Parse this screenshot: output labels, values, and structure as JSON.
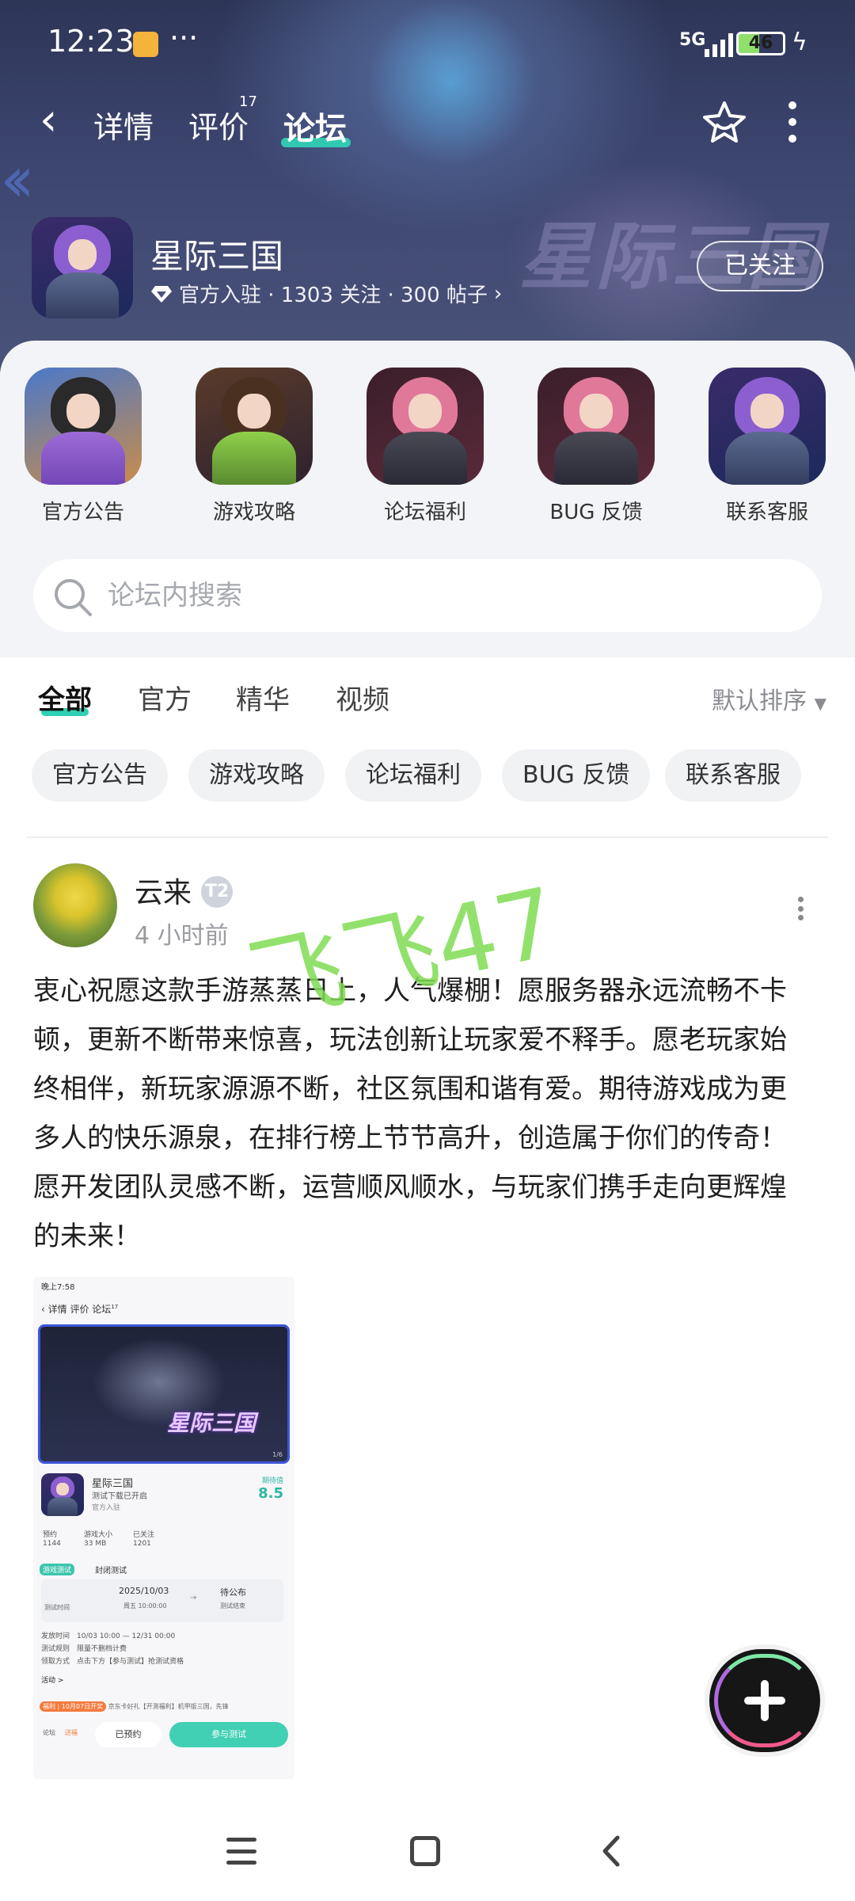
{
  "status_bar": {
    "time": "12:23",
    "dots": "···",
    "network": "5G",
    "battery": "46"
  },
  "nav": {
    "tabs": [
      {
        "label": "详情"
      },
      {
        "label": "评价",
        "badge": "17"
      },
      {
        "label": "论坛"
      }
    ],
    "active_tab": "论坛"
  },
  "game": {
    "name": "星际三国",
    "meta": "官方入驻 · 1303 关注 · 300 帖子",
    "follow_label": "已关注",
    "hero_logo": "星际三国"
  },
  "categories": [
    {
      "label": "官方公告"
    },
    {
      "label": "游戏攻略"
    },
    {
      "label": "论坛福利"
    },
    {
      "label": "BUG 反馈"
    },
    {
      "label": "联系客服"
    }
  ],
  "search": {
    "placeholder": "论坛内搜索"
  },
  "feed_tabs": [
    {
      "label": "全部"
    },
    {
      "label": "官方"
    },
    {
      "label": "精华"
    },
    {
      "label": "视频"
    }
  ],
  "sort_label": "默认排序",
  "chips": [
    "官方公告",
    "游戏攻略",
    "论坛福利",
    "BUG 反馈",
    "联系客服"
  ],
  "post": {
    "author": "云来",
    "author_badge": "T2",
    "time": "4 小时前",
    "content": "衷心祝愿这款手游蒸蒸日上，人气爆棚！愿服务器永远流畅不卡顿，更新不断带来惊喜，玩法创新让玩家爱不释手。愿老玩家始终相伴，新玩家源源不断，社区氛围和谐有爱。期待游戏成为更多人的快乐源泉，在排行榜上节节高升，创造属于你们的传奇！愿开发团队灵感不断，运营顺风顺水，与玩家们携手走向更辉煌的未来！",
    "watermark": "飞飞47"
  },
  "embedded_shot": {
    "status_time": "晚上7:58",
    "nav_tabs": "详情  评价  论坛",
    "nav_badge": "17",
    "banner_logo": "星际三国",
    "banner_page": "1/6",
    "name": "星际三国",
    "subtitle": "测试下载已开启",
    "official": "官方入驻",
    "score_label": "期待值",
    "score": "8.5",
    "stats": [
      {
        "label": "预约",
        "value": "1144"
      },
      {
        "label": "游戏大小",
        "value": "33 MB"
      },
      {
        "label": "已关注",
        "value": "1201"
      }
    ],
    "test_tag": "游戏测试",
    "test_type": "封闭测试",
    "test_time_label": "测试时间",
    "date_start": "2025/10/03",
    "date_start_sub": "周五 10:00:00",
    "date_end": "待公布",
    "date_end_sub": "测试结束",
    "rows": [
      {
        "label": "发放时间",
        "value": "10/03 10:00 — 12/31 00:00"
      },
      {
        "label": "测试规则",
        "value": "限量不删档计费"
      },
      {
        "label": "领取方式",
        "value": "点击下方【参与测试】抢测试资格"
      }
    ],
    "activity": "活动 >",
    "news_tag": "福利 | 10月07日开奖",
    "news_text": "京东卡好礼【开测福利】机甲版三国，先锋",
    "foot_icons": [
      "论坛",
      "送福"
    ],
    "btn_reserved": "已预约",
    "btn_join": "参与测试"
  },
  "colors": {
    "accent": "#2fd0b3",
    "hero_dark": "#2d3557"
  }
}
